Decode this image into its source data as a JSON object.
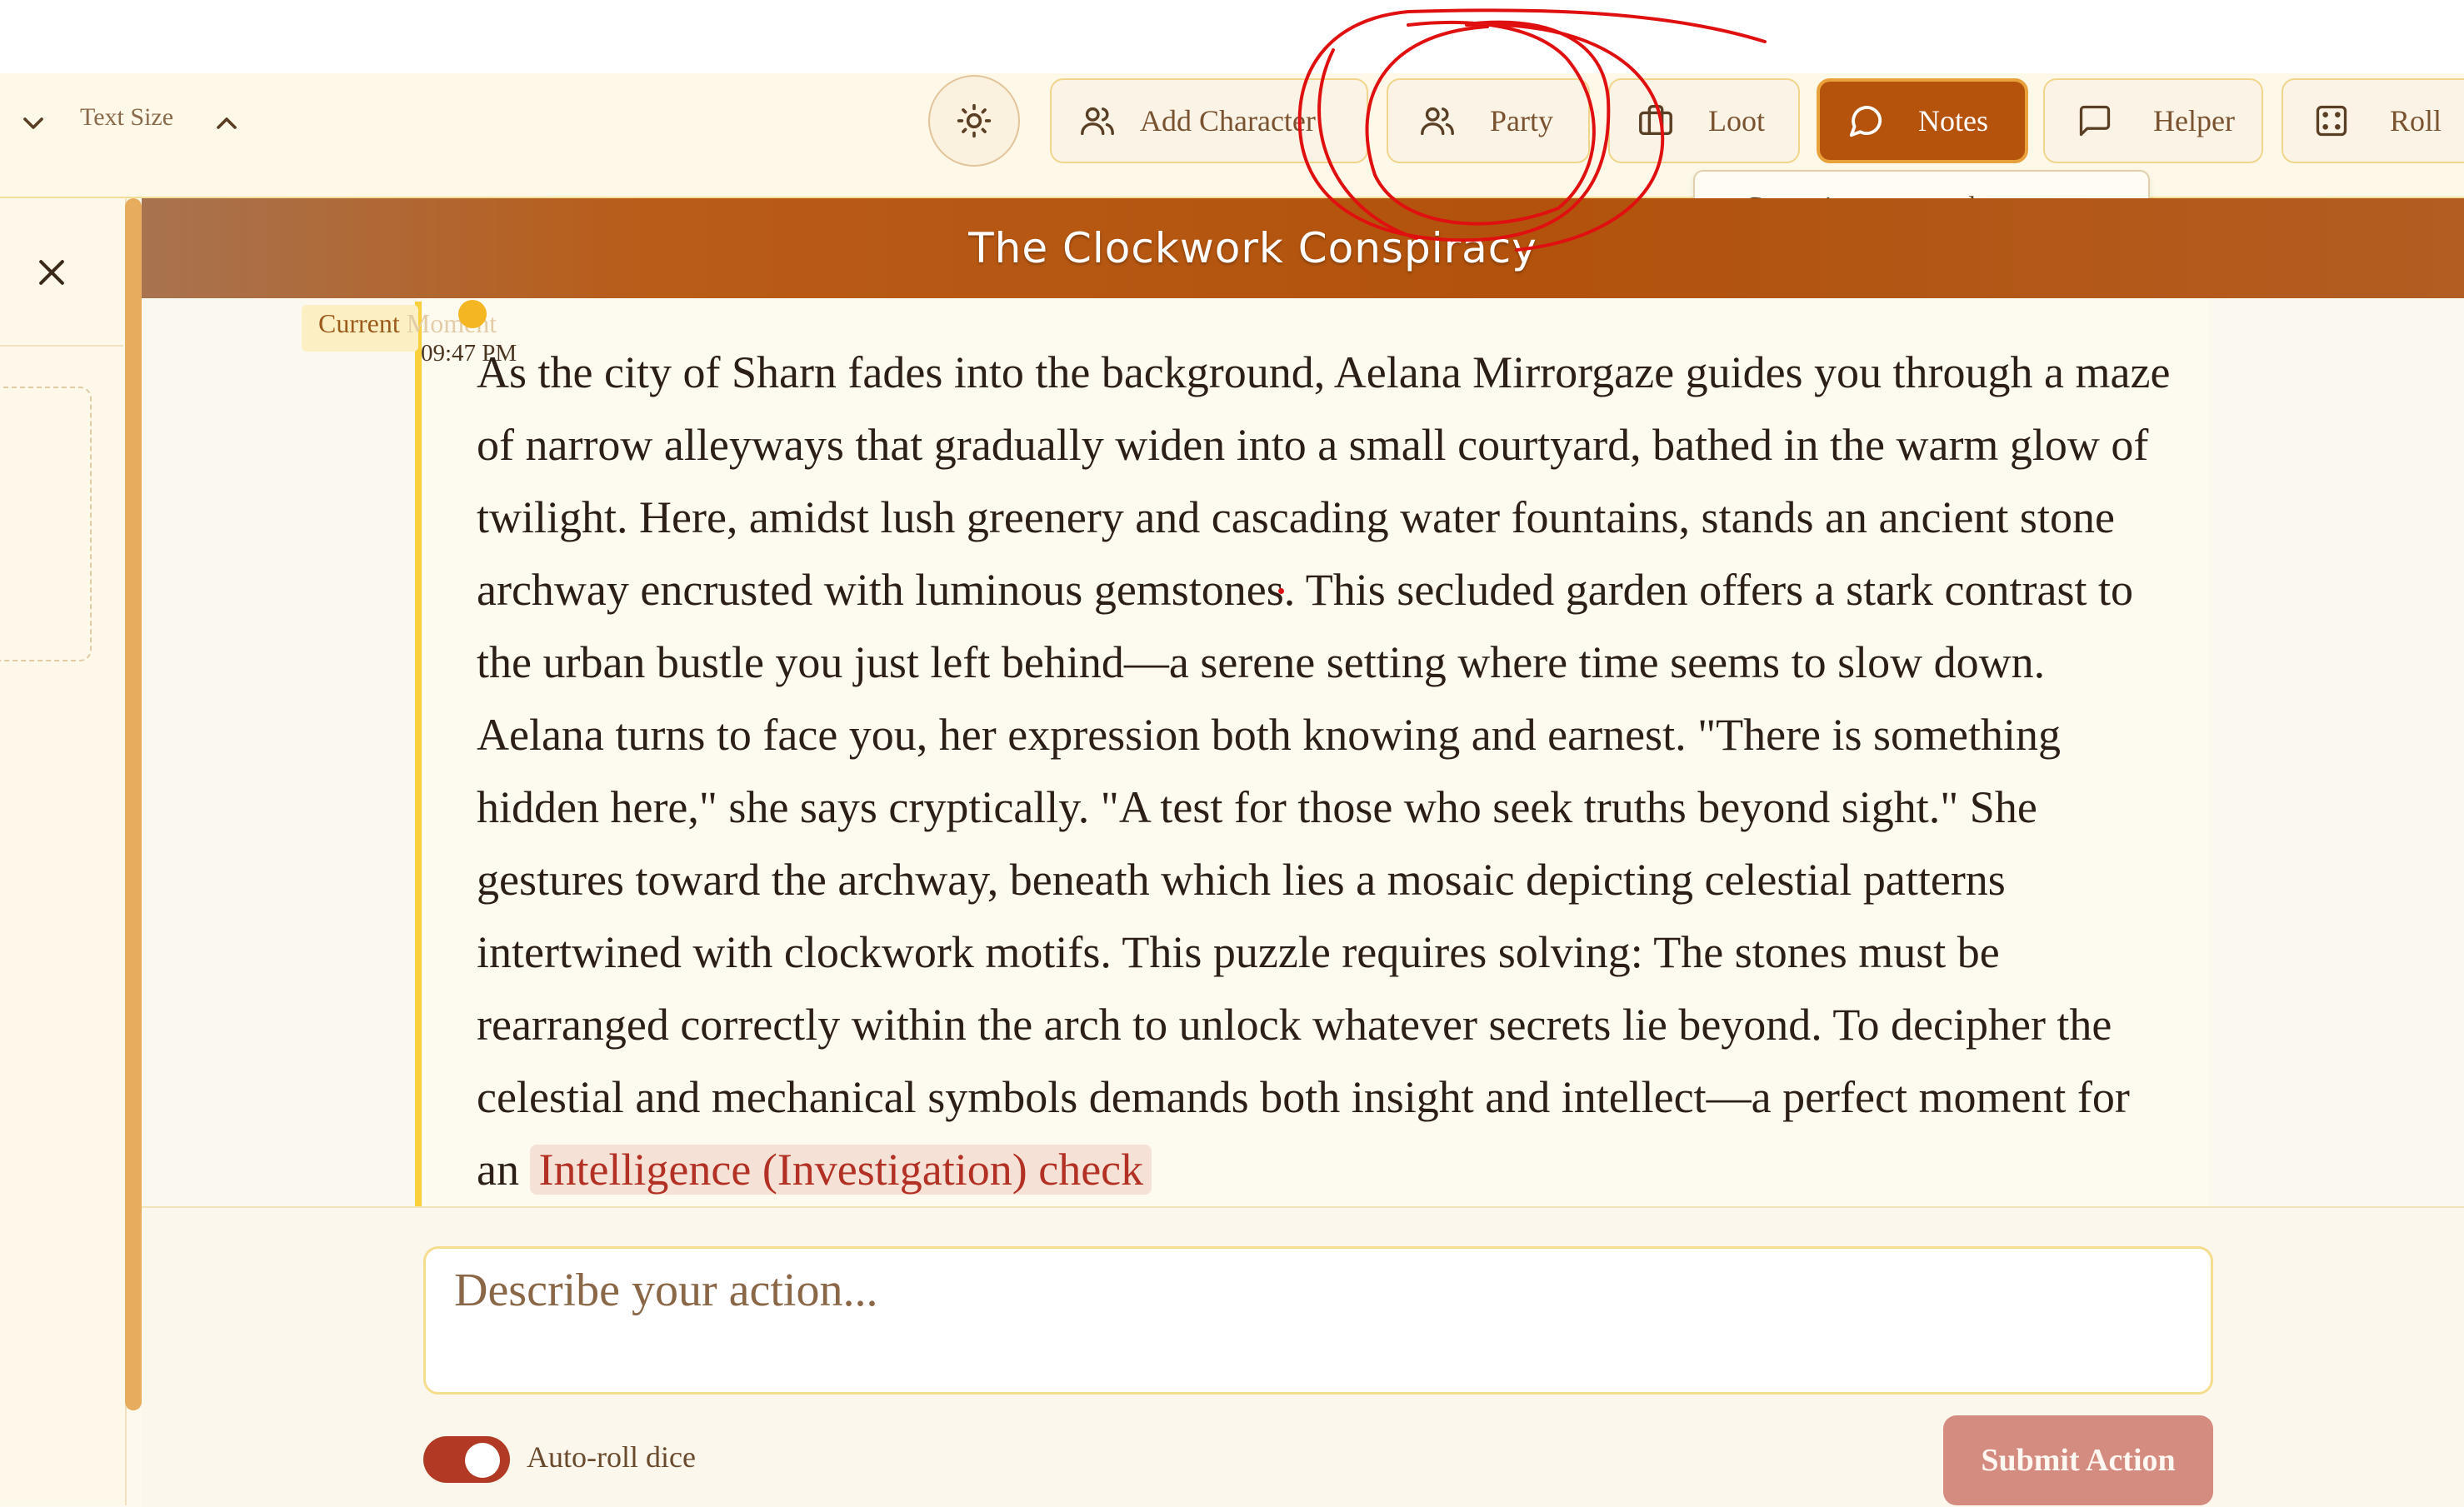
{
  "toolbar": {
    "text_size_label": "Text Size",
    "buttons": [
      {
        "label": "Add Character",
        "icon": "users-icon"
      },
      {
        "label": "Party",
        "icon": "users-icon"
      },
      {
        "label": "Loot",
        "icon": "briefcase-icon"
      },
      {
        "label": "Notes",
        "icon": "message-circle-icon",
        "active": true
      },
      {
        "label": "Helper",
        "icon": "message-square-icon"
      },
      {
        "label": "Roll",
        "icon": "dice-icon"
      }
    ],
    "tooltip": "Campaign notes and comments"
  },
  "campaign": {
    "title": "The Clockwork Conspiracy"
  },
  "story": {
    "moment_label_visible": "Current",
    "moment_label_faded": "Moment",
    "time": "09:47 PM",
    "text": "As the city of Sharn fades into the background, Aelana Mirrorgaze guides you through a maze of narrow alleyways that gradually widen into a small courtyard, bathed in the warm glow of twilight. Here, amidst lush greenery and cascading water fountains, stands an ancient stone archway encrusted with luminous gemstones. This secluded garden offers a stark contrast to the urban bustle you just left behind—a serene setting where time seems to slow down. Aelana turns to face you, her expression both knowing and earnest. \"There is something hidden here,\" she says cryptically. \"A test for those who seek truths beyond sight.\" She gestures toward the archway, beneath which lies a mosaic depicting celestial patterns intertwined with clockwork motifs. This puzzle requires solving: The stones must be rearranged correctly within the arch to unlock whatever secrets lie beyond. To decipher the celestial and mechanical symbols demands both insight and intellect—a perfect moment for an",
    "check": "Intelligence (Investigation) check"
  },
  "action": {
    "placeholder": "Describe your action...",
    "auto_roll_label": "Auto-roll dice",
    "auto_roll_on": true,
    "submit_label": "Submit Action"
  },
  "colors": {
    "accent": "#b5530c",
    "highlight_bar": "#fad13d",
    "check_text": "#b23024",
    "submit_bg": "#d48c80",
    "annotation": "#e01010"
  }
}
